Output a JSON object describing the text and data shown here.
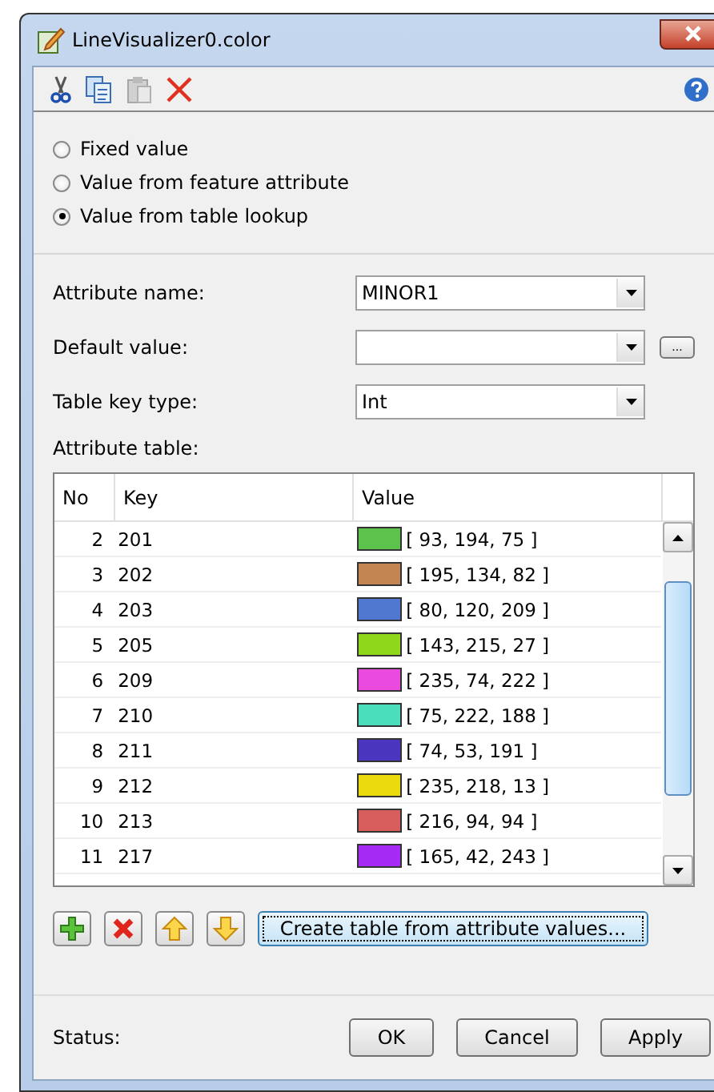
{
  "window": {
    "title": "LineVisualizer0.color"
  },
  "toolbar": [
    {
      "kind": "cut",
      "disabled": false
    },
    {
      "kind": "copy",
      "disabled": false
    },
    {
      "kind": "paste",
      "disabled": true
    },
    {
      "kind": "delete",
      "disabled": false
    }
  ],
  "value_source": [
    {
      "label": "Fixed value",
      "selected": false
    },
    {
      "label": "Value from feature attribute",
      "selected": false
    },
    {
      "label": "Value from table lookup",
      "selected": true
    }
  ],
  "fields": [
    {
      "label": "Attribute name:",
      "value": "MINOR1"
    },
    {
      "label": "Default value:",
      "browse_button": "..."
    },
    {
      "label": "Table key type:",
      "value": "Int"
    }
  ],
  "attribute_table": {
    "label": "Attribute table:",
    "columns": [
      "No",
      "Key",
      "Value"
    ],
    "rows": [
      {
        "no": "2",
        "key": "201",
        "value": "[ 93, 194, 75 ]",
        "color": "#5dc24b"
      },
      {
        "no": "3",
        "key": "202",
        "value": "[ 195, 134, 82 ]",
        "color": "#c38652"
      },
      {
        "no": "4",
        "key": "203",
        "value": "[ 80, 120, 209 ]",
        "color": "#5078d1"
      },
      {
        "no": "5",
        "key": "205",
        "value": "[ 143, 215, 27 ]",
        "color": "#8fd71b"
      },
      {
        "no": "6",
        "key": "209",
        "value": "[ 235, 74, 222 ]",
        "color": "#eb4ade"
      },
      {
        "no": "7",
        "key": "210",
        "value": "[ 75, 222, 188 ]",
        "color": "#4bdebc"
      },
      {
        "no": "8",
        "key": "211",
        "value": "[ 74, 53, 191 ]",
        "color": "#4a35bf"
      },
      {
        "no": "9",
        "key": "212",
        "value": "[ 235, 218, 13 ]",
        "color": "#ebda0d"
      },
      {
        "no": "10",
        "key": "213",
        "value": "[ 216, 94, 94 ]",
        "color": "#d85e5e"
      },
      {
        "no": "11",
        "key": "217",
        "value": "[ 165, 42, 243 ]",
        "color": "#a52af3"
      }
    ]
  },
  "table_buttons": [
    {
      "kind": "add"
    },
    {
      "kind": "remove"
    },
    {
      "kind": "up"
    },
    {
      "kind": "down"
    }
  ],
  "create_button": "Create table from attribute values...",
  "status": {
    "label": "Status:"
  },
  "buttons": [
    "OK",
    "Cancel",
    "Apply"
  ]
}
